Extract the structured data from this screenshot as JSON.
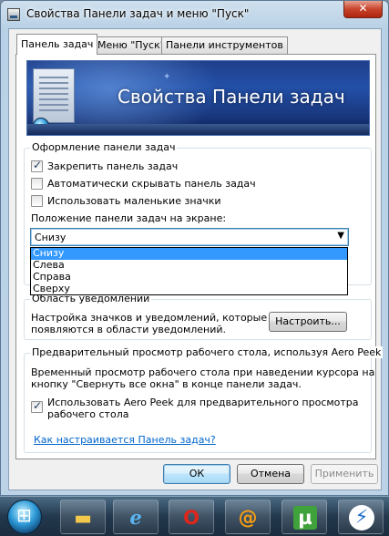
{
  "window": {
    "title": "Свойства Панели задач и меню \"Пуск\"",
    "close_label": "✕"
  },
  "tabs": [
    {
      "label": "Панель задач"
    },
    {
      "label": "Меню \"Пуск\""
    },
    {
      "label": "Панели инструментов"
    }
  ],
  "banner": {
    "title": "Свойства Панели задач"
  },
  "appearance": {
    "legend": "Оформление панели задач",
    "lock_taskbar": {
      "label": "Закрепить панель задач",
      "checked": true
    },
    "auto_hide": {
      "label": "Автоматически скрывать панель задач",
      "checked": false
    },
    "small_icons": {
      "label": "Использовать маленькие значки",
      "checked": false
    },
    "position_label": "Положение панели задач на экране:",
    "position_value": "Снизу",
    "position_options": [
      "Снизу",
      "Слева",
      "Справа",
      "Сверху"
    ]
  },
  "notifications": {
    "legend": "Область уведомлений",
    "description": "Настройка значков и уведомлений, которые появляются в области уведомлений.",
    "description_line1": "Настройка значков и уведомлений, которые",
    "description_line2": "появляются в области уведомлений.",
    "customize_label": "Настроить..."
  },
  "aero_peek": {
    "legend": "Предварительный просмотр рабочего стола, используя Aero Peek",
    "description_line1": "Временный просмотр рабочего стола при наведении курсора на",
    "description_line2": "кнопку \"Свернуть все окна\" в конце панели задач.",
    "use_peek_line1": "Использовать Aero Peek для предварительного просмотра",
    "use_peek_line2": "рабочего стола",
    "use_peek_checked": true
  },
  "help_link": "Как настраивается Панель задач?",
  "buttons": {
    "ok": "ОК",
    "cancel": "Отмена",
    "apply": "Применить"
  },
  "taskbar": {
    "icons": [
      "windows-start-icon",
      "explorer-folder-icon",
      "internet-explorer-icon",
      "opera-icon",
      "mail-agent-icon",
      "utorrent-icon",
      "lightning-app-icon"
    ],
    "utorrent_glyph": "µ"
  }
}
